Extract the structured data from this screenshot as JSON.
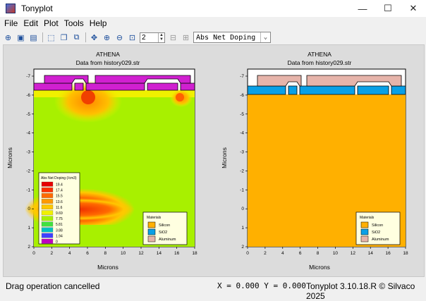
{
  "window": {
    "title": "Tonyplot",
    "minimize": "—",
    "maximize": "☐",
    "close": "✕"
  },
  "menu": [
    "File",
    "Edit",
    "Plot",
    "Tools",
    "Help"
  ],
  "toolbar": {
    "zoom_level": "2",
    "quantity": "Abs Net Doping"
  },
  "plots": [
    {
      "id": "left",
      "title": "ATHENA",
      "subtitle": "Data from history029.str",
      "xlabel": "Microns",
      "ylabel": "Microns",
      "xticks": [
        "0",
        "2",
        "4",
        "6",
        "8",
        "10",
        "12",
        "14",
        "16",
        "18"
      ],
      "yticks": [
        "-7",
        "-6",
        "-5",
        "-4",
        "-3",
        "-2",
        "-1",
        "0",
        "1",
        "2"
      ],
      "legend": {
        "title": "Abs Net Doping (/cm3)",
        "values": [
          "19.4",
          "17.4",
          "15.5",
          "13.6",
          "11.6",
          "9.69",
          "7.75",
          "5.81",
          "3.88",
          "1.94",
          "0"
        ]
      },
      "materials": {
        "title": "Materials",
        "items": [
          "Silicon",
          "SiO2",
          "Aluminum"
        ]
      }
    },
    {
      "id": "right",
      "title": "ATHENA",
      "subtitle": "Data from history029.str",
      "xlabel": "Microns",
      "ylabel": "Microns",
      "xticks": [
        "0",
        "2",
        "4",
        "6",
        "8",
        "10",
        "12",
        "14",
        "16",
        "18"
      ],
      "yticks": [
        "-7",
        "-6",
        "-5",
        "-4",
        "-3",
        "-2",
        "-1",
        "0",
        "1",
        "2"
      ],
      "materials": {
        "title": "Materials",
        "items": [
          "Silicon",
          "SiO2",
          "Aluminum"
        ]
      }
    }
  ],
  "colors": {
    "silicon": "#ffb000",
    "sio2": "#0aa0e6",
    "aluminum": "#e6b4aa",
    "doping_bg": "#a8f000",
    "oxide_layer": "#d020d0"
  },
  "legend_colors": [
    "#e60000",
    "#ff3000",
    "#ff6a00",
    "#ff9a00",
    "#ffc800",
    "#f0f000",
    "#a8f000",
    "#40e040",
    "#00c0c0",
    "#4040ff",
    "#c000c0"
  ],
  "status": {
    "message": "Drag operation cancelled",
    "coords": "X = 0.000 Y = 0.000",
    "version": "Tonyplot 3.10.18.R © Silvaco 2025"
  }
}
